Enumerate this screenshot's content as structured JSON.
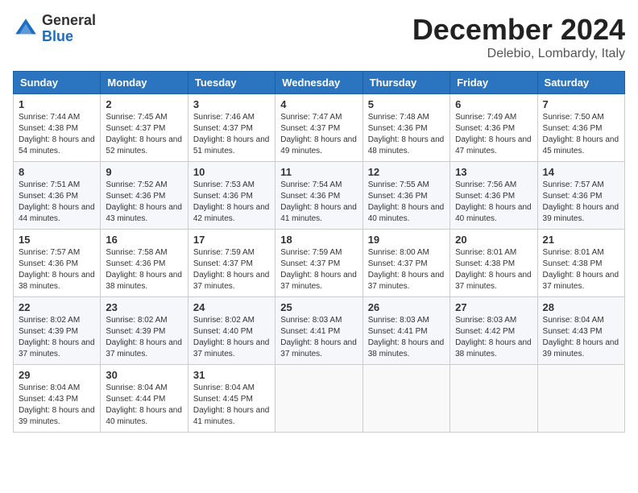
{
  "header": {
    "logo_general": "General",
    "logo_blue": "Blue",
    "month_title": "December 2024",
    "location": "Delebio, Lombardy, Italy"
  },
  "columns": [
    "Sunday",
    "Monday",
    "Tuesday",
    "Wednesday",
    "Thursday",
    "Friday",
    "Saturday"
  ],
  "rows": [
    [
      {
        "day": "1",
        "sunrise": "Sunrise: 7:44 AM",
        "sunset": "Sunset: 4:38 PM",
        "daylight": "Daylight: 8 hours and 54 minutes."
      },
      {
        "day": "2",
        "sunrise": "Sunrise: 7:45 AM",
        "sunset": "Sunset: 4:37 PM",
        "daylight": "Daylight: 8 hours and 52 minutes."
      },
      {
        "day": "3",
        "sunrise": "Sunrise: 7:46 AM",
        "sunset": "Sunset: 4:37 PM",
        "daylight": "Daylight: 8 hours and 51 minutes."
      },
      {
        "day": "4",
        "sunrise": "Sunrise: 7:47 AM",
        "sunset": "Sunset: 4:37 PM",
        "daylight": "Daylight: 8 hours and 49 minutes."
      },
      {
        "day": "5",
        "sunrise": "Sunrise: 7:48 AM",
        "sunset": "Sunset: 4:36 PM",
        "daylight": "Daylight: 8 hours and 48 minutes."
      },
      {
        "day": "6",
        "sunrise": "Sunrise: 7:49 AM",
        "sunset": "Sunset: 4:36 PM",
        "daylight": "Daylight: 8 hours and 47 minutes."
      },
      {
        "day": "7",
        "sunrise": "Sunrise: 7:50 AM",
        "sunset": "Sunset: 4:36 PM",
        "daylight": "Daylight: 8 hours and 45 minutes."
      }
    ],
    [
      {
        "day": "8",
        "sunrise": "Sunrise: 7:51 AM",
        "sunset": "Sunset: 4:36 PM",
        "daylight": "Daylight: 8 hours and 44 minutes."
      },
      {
        "day": "9",
        "sunrise": "Sunrise: 7:52 AM",
        "sunset": "Sunset: 4:36 PM",
        "daylight": "Daylight: 8 hours and 43 minutes."
      },
      {
        "day": "10",
        "sunrise": "Sunrise: 7:53 AM",
        "sunset": "Sunset: 4:36 PM",
        "daylight": "Daylight: 8 hours and 42 minutes."
      },
      {
        "day": "11",
        "sunrise": "Sunrise: 7:54 AM",
        "sunset": "Sunset: 4:36 PM",
        "daylight": "Daylight: 8 hours and 41 minutes."
      },
      {
        "day": "12",
        "sunrise": "Sunrise: 7:55 AM",
        "sunset": "Sunset: 4:36 PM",
        "daylight": "Daylight: 8 hours and 40 minutes."
      },
      {
        "day": "13",
        "sunrise": "Sunrise: 7:56 AM",
        "sunset": "Sunset: 4:36 PM",
        "daylight": "Daylight: 8 hours and 40 minutes."
      },
      {
        "day": "14",
        "sunrise": "Sunrise: 7:57 AM",
        "sunset": "Sunset: 4:36 PM",
        "daylight": "Daylight: 8 hours and 39 minutes."
      }
    ],
    [
      {
        "day": "15",
        "sunrise": "Sunrise: 7:57 AM",
        "sunset": "Sunset: 4:36 PM",
        "daylight": "Daylight: 8 hours and 38 minutes."
      },
      {
        "day": "16",
        "sunrise": "Sunrise: 7:58 AM",
        "sunset": "Sunset: 4:36 PM",
        "daylight": "Daylight: 8 hours and 38 minutes."
      },
      {
        "day": "17",
        "sunrise": "Sunrise: 7:59 AM",
        "sunset": "Sunset: 4:37 PM",
        "daylight": "Daylight: 8 hours and 37 minutes."
      },
      {
        "day": "18",
        "sunrise": "Sunrise: 7:59 AM",
        "sunset": "Sunset: 4:37 PM",
        "daylight": "Daylight: 8 hours and 37 minutes."
      },
      {
        "day": "19",
        "sunrise": "Sunrise: 8:00 AM",
        "sunset": "Sunset: 4:37 PM",
        "daylight": "Daylight: 8 hours and 37 minutes."
      },
      {
        "day": "20",
        "sunrise": "Sunrise: 8:01 AM",
        "sunset": "Sunset: 4:38 PM",
        "daylight": "Daylight: 8 hours and 37 minutes."
      },
      {
        "day": "21",
        "sunrise": "Sunrise: 8:01 AM",
        "sunset": "Sunset: 4:38 PM",
        "daylight": "Daylight: 8 hours and 37 minutes."
      }
    ],
    [
      {
        "day": "22",
        "sunrise": "Sunrise: 8:02 AM",
        "sunset": "Sunset: 4:39 PM",
        "daylight": "Daylight: 8 hours and 37 minutes."
      },
      {
        "day": "23",
        "sunrise": "Sunrise: 8:02 AM",
        "sunset": "Sunset: 4:39 PM",
        "daylight": "Daylight: 8 hours and 37 minutes."
      },
      {
        "day": "24",
        "sunrise": "Sunrise: 8:02 AM",
        "sunset": "Sunset: 4:40 PM",
        "daylight": "Daylight: 8 hours and 37 minutes."
      },
      {
        "day": "25",
        "sunrise": "Sunrise: 8:03 AM",
        "sunset": "Sunset: 4:41 PM",
        "daylight": "Daylight: 8 hours and 37 minutes."
      },
      {
        "day": "26",
        "sunrise": "Sunrise: 8:03 AM",
        "sunset": "Sunset: 4:41 PM",
        "daylight": "Daylight: 8 hours and 38 minutes."
      },
      {
        "day": "27",
        "sunrise": "Sunrise: 8:03 AM",
        "sunset": "Sunset: 4:42 PM",
        "daylight": "Daylight: 8 hours and 38 minutes."
      },
      {
        "day": "28",
        "sunrise": "Sunrise: 8:04 AM",
        "sunset": "Sunset: 4:43 PM",
        "daylight": "Daylight: 8 hours and 39 minutes."
      }
    ],
    [
      {
        "day": "29",
        "sunrise": "Sunrise: 8:04 AM",
        "sunset": "Sunset: 4:43 PM",
        "daylight": "Daylight: 8 hours and 39 minutes."
      },
      {
        "day": "30",
        "sunrise": "Sunrise: 8:04 AM",
        "sunset": "Sunset: 4:44 PM",
        "daylight": "Daylight: 8 hours and 40 minutes."
      },
      {
        "day": "31",
        "sunrise": "Sunrise: 8:04 AM",
        "sunset": "Sunset: 4:45 PM",
        "daylight": "Daylight: 8 hours and 41 minutes."
      },
      null,
      null,
      null,
      null
    ]
  ]
}
